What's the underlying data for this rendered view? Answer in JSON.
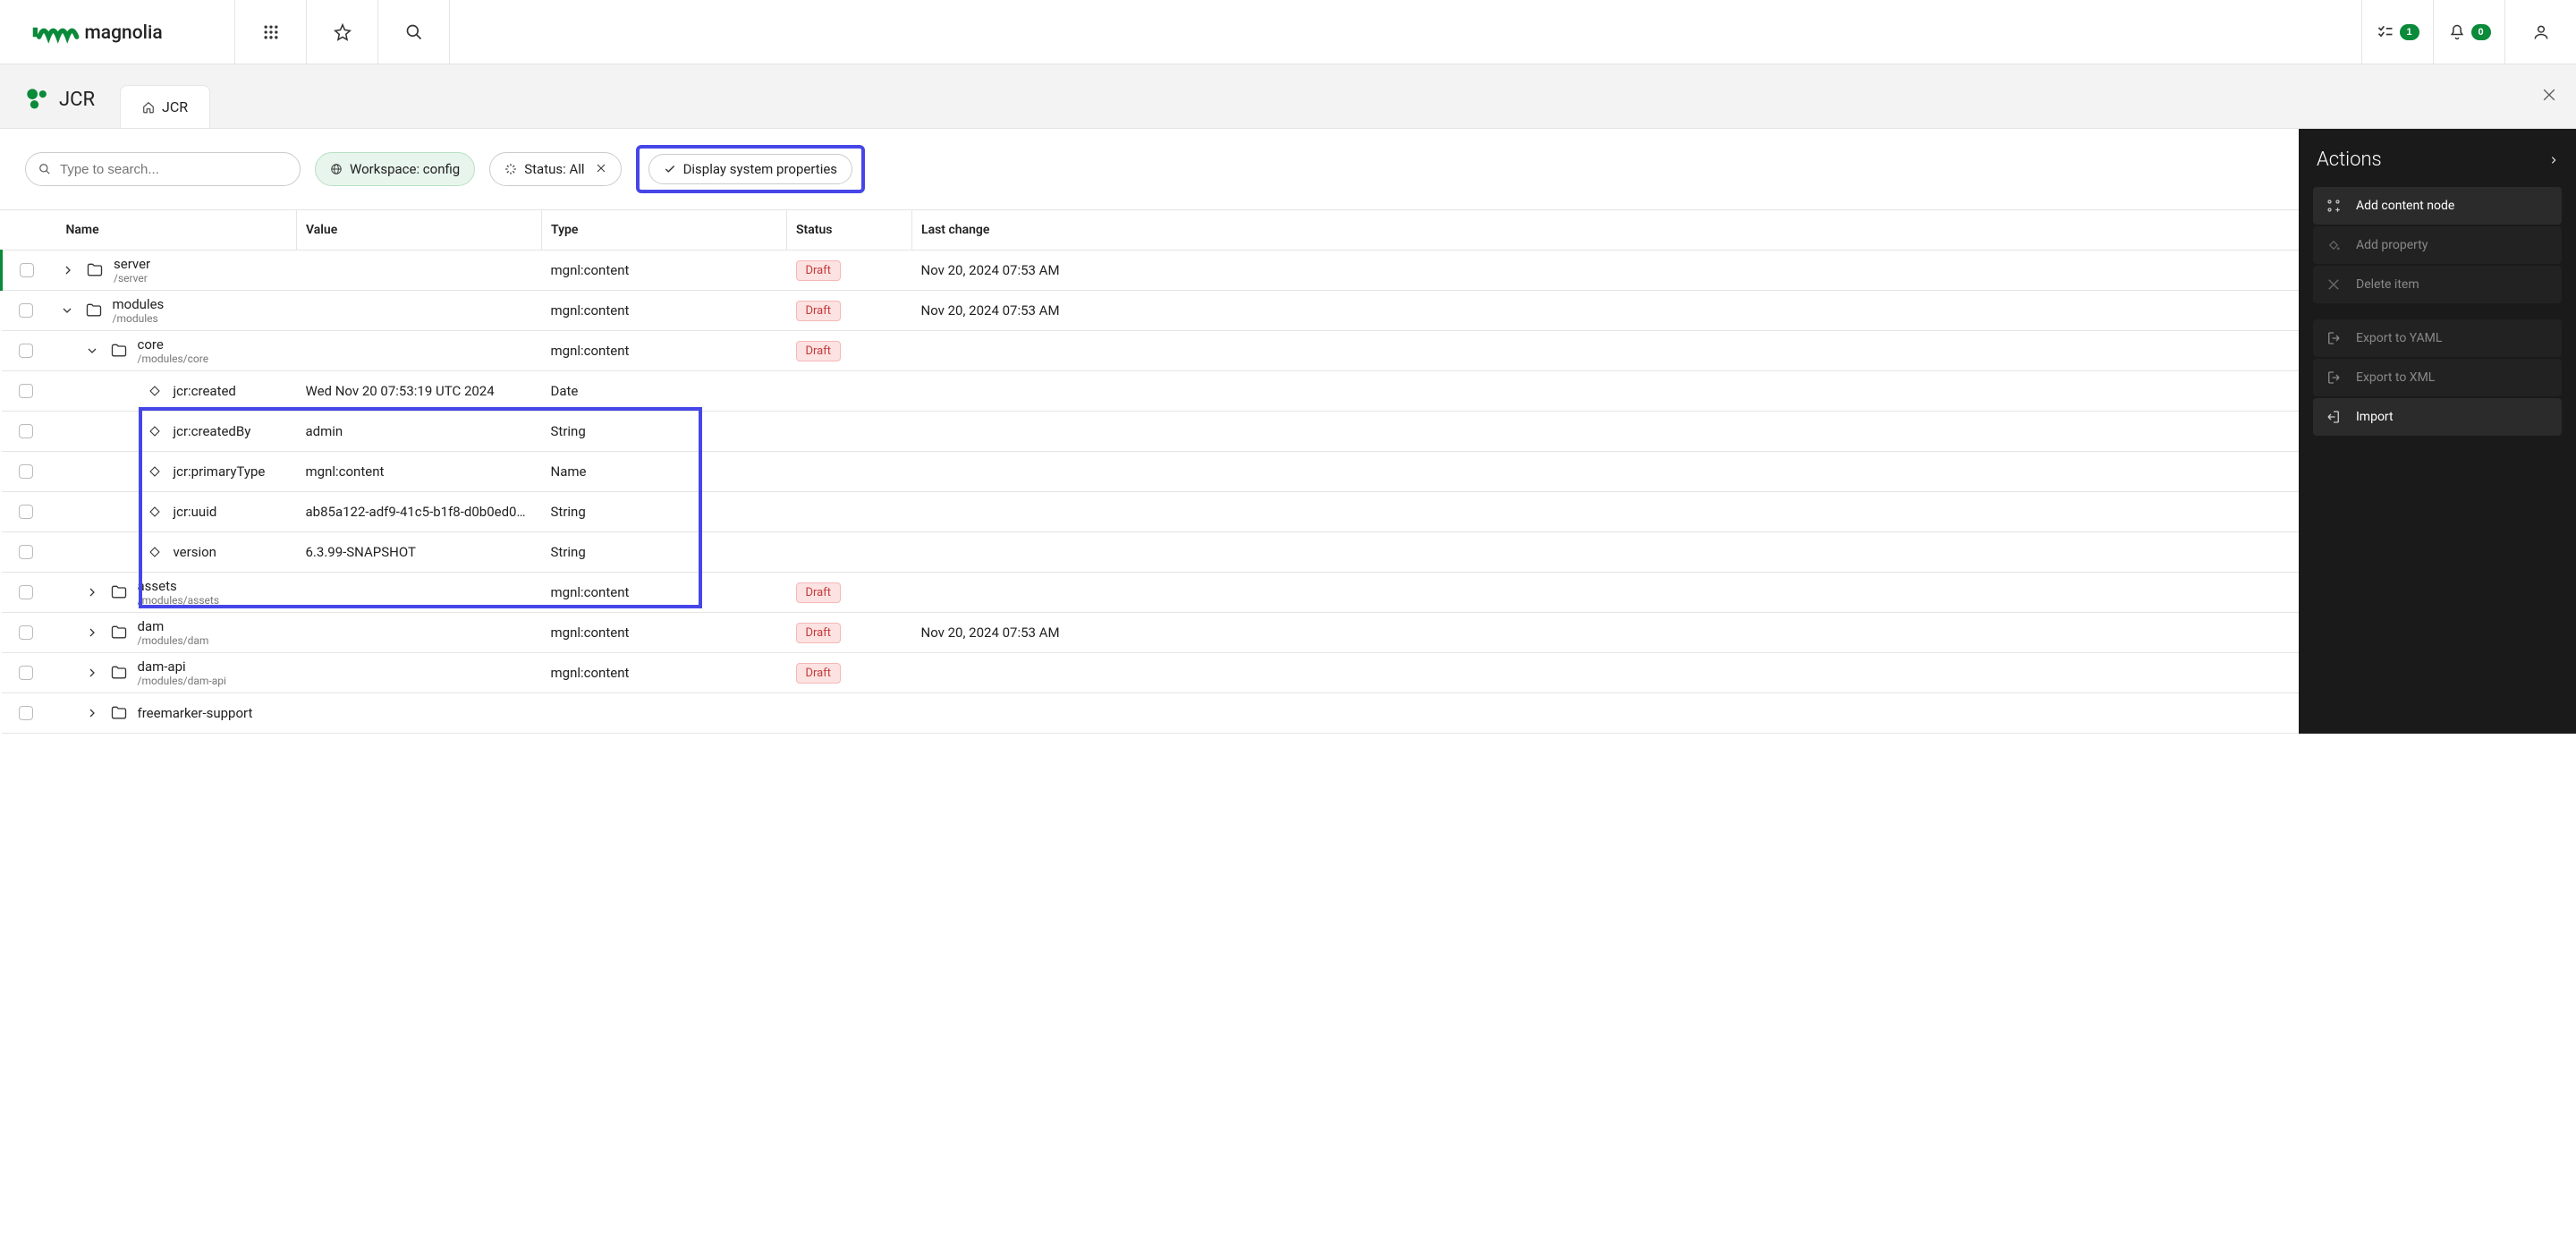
{
  "header": {
    "brand": "magnolia",
    "tasks_count": "1",
    "notifications_count": "0"
  },
  "app": {
    "title": "JCR",
    "tab_label": "JCR"
  },
  "filters": {
    "search_placeholder": "Type to search...",
    "workspace_label": "Workspace: config",
    "status_label": "Status: All",
    "display_sys_label": "Display system properties"
  },
  "columns": {
    "name": "Name",
    "value": "Value",
    "type": "Type",
    "status": "Status",
    "last_change": "Last change"
  },
  "status_draft": "Draft",
  "rows": [
    {
      "kind": "folder",
      "depth": 0,
      "expanded": false,
      "name": "server",
      "path": "/server",
      "value": "",
      "type": "mgnl:content",
      "status": "Draft",
      "last_change": "Nov 20, 2024 07:53 AM",
      "green": true
    },
    {
      "kind": "folder",
      "depth": 0,
      "expanded": true,
      "name": "modules",
      "path": "/modules",
      "value": "",
      "type": "mgnl:content",
      "status": "Draft",
      "last_change": "Nov 20, 2024 07:53 AM"
    },
    {
      "kind": "folder",
      "depth": 1,
      "expanded": true,
      "name": "core",
      "path": "/modules/core",
      "value": "",
      "type": "mgnl:content",
      "status": "Draft",
      "last_change": ""
    },
    {
      "kind": "prop",
      "depth": 2,
      "name": "jcr:created",
      "value": "Wed Nov 20 07:53:19 UTC 2024",
      "type": "Date"
    },
    {
      "kind": "prop",
      "depth": 2,
      "name": "jcr:createdBy",
      "value": "admin",
      "type": "String"
    },
    {
      "kind": "prop",
      "depth": 2,
      "name": "jcr:primaryType",
      "value": "mgnl:content",
      "type": "Name"
    },
    {
      "kind": "prop",
      "depth": 2,
      "name": "jcr:uuid",
      "value": "ab85a122-adf9-41c5-b1f8-d0b0ed0…",
      "type": "String"
    },
    {
      "kind": "prop",
      "depth": 2,
      "name": "version",
      "value": "6.3.99-SNAPSHOT",
      "type": "String"
    },
    {
      "kind": "folder",
      "depth": 1,
      "expanded": false,
      "name": "assets",
      "path": "/modules/assets",
      "value": "",
      "type": "mgnl:content",
      "status": "Draft",
      "last_change": ""
    },
    {
      "kind": "folder",
      "depth": 1,
      "expanded": false,
      "name": "dam",
      "path": "/modules/dam",
      "value": "",
      "type": "mgnl:content",
      "status": "Draft",
      "last_change": "Nov 20, 2024 07:53 AM"
    },
    {
      "kind": "folder",
      "depth": 1,
      "expanded": false,
      "name": "dam-api",
      "path": "/modules/dam-api",
      "value": "",
      "type": "mgnl:content",
      "status": "Draft",
      "last_change": ""
    },
    {
      "kind": "folder",
      "depth": 1,
      "expanded": false,
      "name": "freemarker-support",
      "path": "",
      "value": "",
      "type": "",
      "status": "",
      "last_change": ""
    }
  ],
  "actions": {
    "title": "Actions",
    "items": [
      {
        "label": "Add content node",
        "enabled": true,
        "icon": "add-node"
      },
      {
        "label": "Add property",
        "enabled": false,
        "icon": "add-prop"
      },
      {
        "label": "Delete item",
        "enabled": false,
        "icon": "delete"
      },
      {
        "gap": true
      },
      {
        "label": "Export to YAML",
        "enabled": false,
        "icon": "export"
      },
      {
        "label": "Export to XML",
        "enabled": false,
        "icon": "export"
      },
      {
        "label": "Import",
        "enabled": true,
        "icon": "import"
      }
    ]
  }
}
